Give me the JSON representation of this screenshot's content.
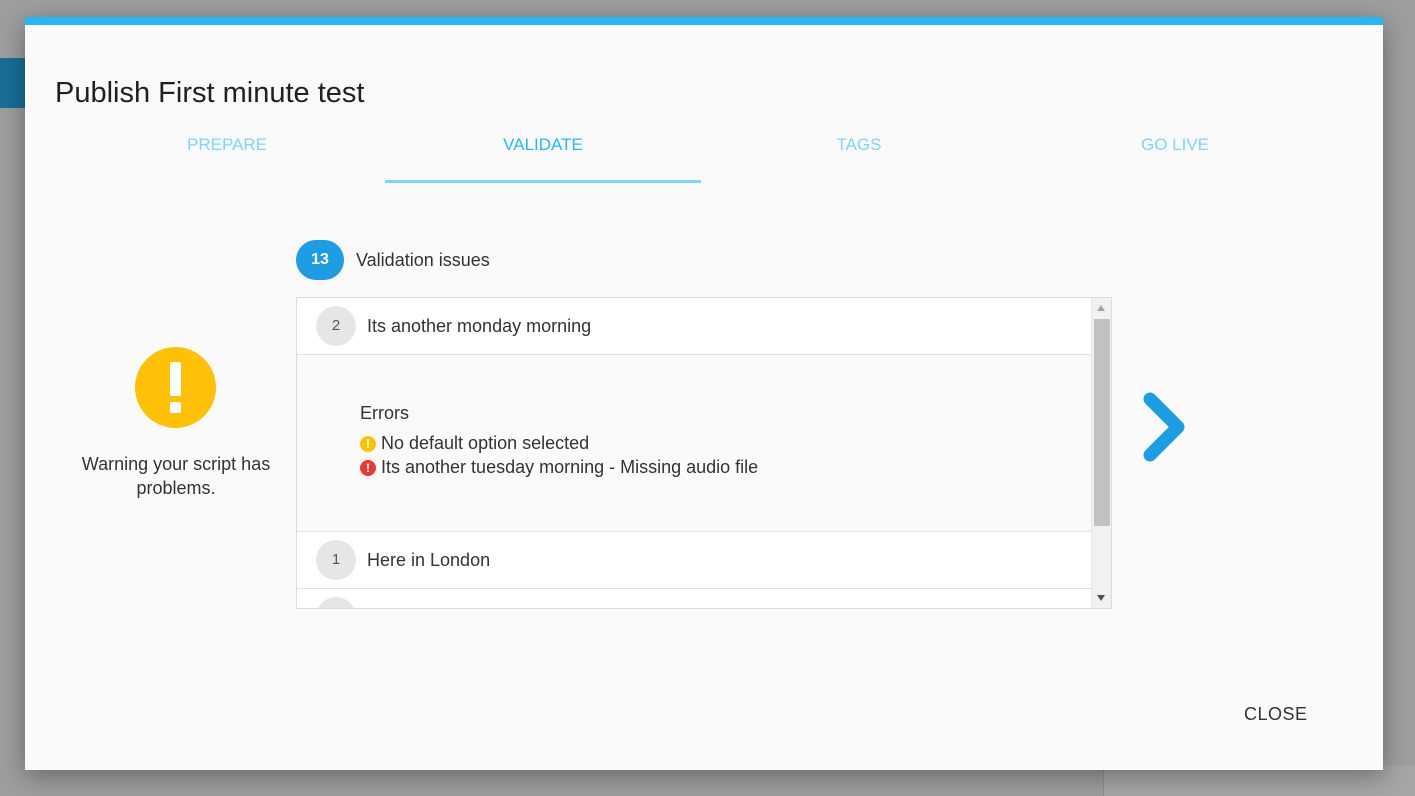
{
  "dialog": {
    "title": "Publish First minute test",
    "accent_color": "#29b6f6"
  },
  "tabs": [
    {
      "label": "PREPARE",
      "active": false
    },
    {
      "label": "VALIDATE",
      "active": true
    },
    {
      "label": "TAGS",
      "active": false
    },
    {
      "label": "GO LIVE",
      "active": false
    }
  ],
  "warning": {
    "icon": "exclamation-icon",
    "color": "#ffc107",
    "message": "Warning your script has problems."
  },
  "issues": {
    "count": "13",
    "label": "Validation issues",
    "rows": [
      {
        "number": "2",
        "title": "Its another monday morning",
        "expanded": true,
        "errors_title": "Errors",
        "errors": [
          {
            "severity": "warning",
            "icon": "warning-icon",
            "text": "No default option selected"
          },
          {
            "severity": "error",
            "icon": "error-icon",
            "text": "Its another tuesday morning - Missing audio file"
          }
        ]
      },
      {
        "number": "1",
        "title": "Here in London",
        "expanded": false
      }
    ]
  },
  "navigation": {
    "next_icon": "chevron-right-icon",
    "color": "#1e9de3"
  },
  "actions": {
    "close_label": "CLOSE"
  }
}
